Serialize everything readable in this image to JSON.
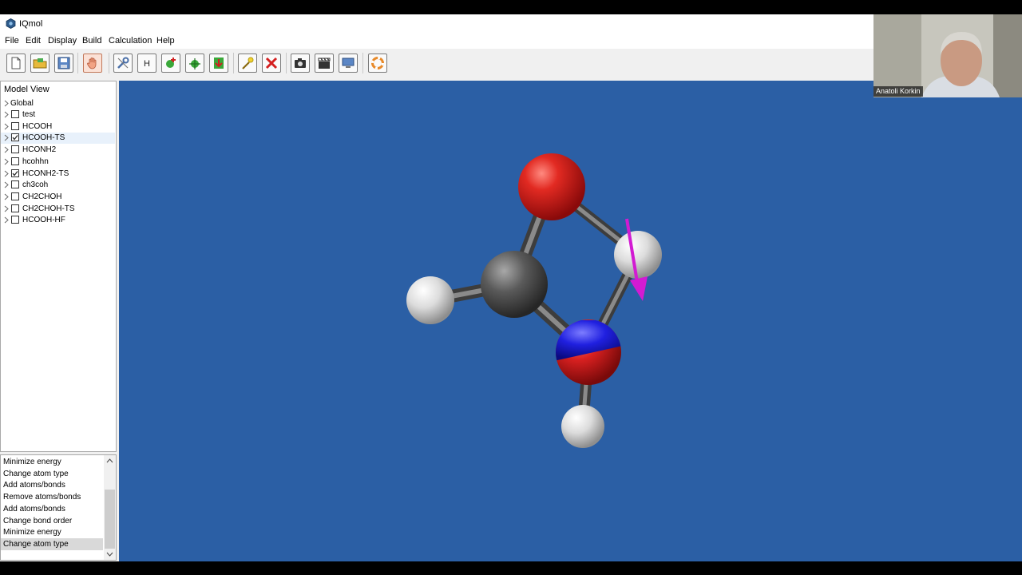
{
  "app": {
    "title": "IQmol",
    "icon": "iqmol-hexagon-icon"
  },
  "menu": [
    "File",
    "Edit",
    "Display",
    "Build",
    "Calculation",
    "Help"
  ],
  "toolbar": {
    "buttons": [
      {
        "name": "new-file-button",
        "icon": "new-document-icon"
      },
      {
        "name": "open-file-button",
        "icon": "open-folder-icon"
      },
      {
        "name": "save-file-button",
        "icon": "save-disk-icon"
      },
      {
        "name": "manipulate-button",
        "icon": "hand-icon"
      },
      {
        "name": "build-button",
        "icon": "wrench-icon"
      },
      {
        "name": "add-hydrogens-button",
        "icon": "hydrogen-icon",
        "label": "H"
      },
      {
        "name": "minimize-energy-button",
        "icon": "add-green-icon"
      },
      {
        "name": "symmetrize-button",
        "icon": "symmetrize-icon"
      },
      {
        "name": "export-button",
        "icon": "down-arrow-icon"
      },
      {
        "name": "select-button",
        "icon": "wand-icon"
      },
      {
        "name": "delete-button",
        "icon": "red-x-icon"
      },
      {
        "name": "snapshot-button",
        "icon": "camera-icon"
      },
      {
        "name": "record-button",
        "icon": "clapper-icon"
      },
      {
        "name": "fullscreen-button",
        "icon": "monitor-icon"
      },
      {
        "name": "reset-view-button",
        "icon": "lifebuoy-icon"
      }
    ]
  },
  "model_view": {
    "header": "Model View",
    "root": "Global",
    "items": [
      {
        "label": "test",
        "checked": false
      },
      {
        "label": "HCOOH",
        "checked": false
      },
      {
        "label": "HCOOH-TS",
        "checked": true
      },
      {
        "label": "HCONH2",
        "checked": false
      },
      {
        "label": "hcohhn",
        "checked": false
      },
      {
        "label": "HCONH2-TS",
        "checked": true
      },
      {
        "label": "ch3coh",
        "checked": false
      },
      {
        "label": "CH2CHOH",
        "checked": false
      },
      {
        "label": "CH2CHOH-TS",
        "checked": false
      },
      {
        "label": "HCOOH-HF",
        "checked": false
      }
    ]
  },
  "undo_history": {
    "items": [
      "Minimize energy",
      "Change atom type",
      "Add atoms/bonds",
      "Remove atoms/bonds",
      "Add atoms/bonds",
      "Change bond order",
      "Minimize energy",
      "Change atom type"
    ],
    "selected_index": 7
  },
  "viewport": {
    "background": "#2b5fa5",
    "atoms": [
      "O",
      "H",
      "C",
      "H",
      "N",
      "H"
    ],
    "colors": {
      "oxygen": "#d42020",
      "carbon": "#555555",
      "hydrogen": "#e6e6e6",
      "nitrogen": "#2424d4",
      "mode_arrow": "#d21bd2"
    }
  },
  "webcam": {
    "name": "Anatoli Korkin"
  }
}
